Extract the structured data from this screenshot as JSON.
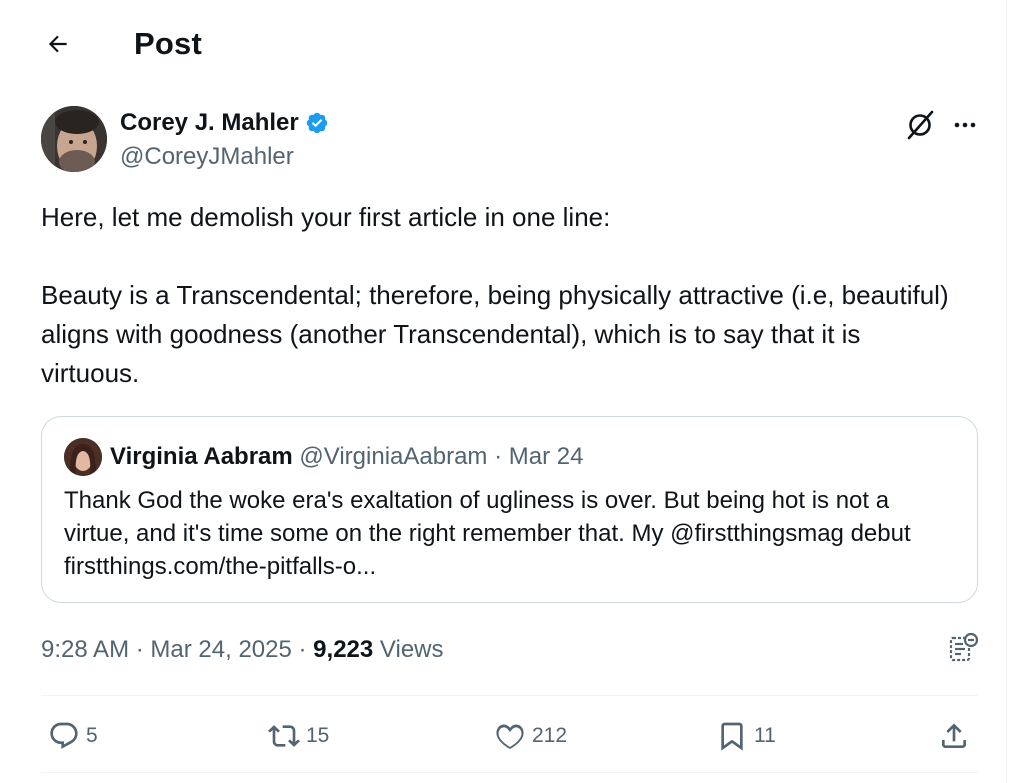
{
  "header": {
    "title": "Post"
  },
  "author": {
    "name": "Corey J. Mahler",
    "handle": "@CoreyJMahler",
    "verified": true
  },
  "post": {
    "text": "Here, let me demolish your first article in one line:\n\nBeauty is a Transcendental; therefore, being physically attractive (i.e, beautiful) aligns with goodness (another Transcendental), which is to say that it is virtuous."
  },
  "quote": {
    "name": "Virginia Aabram",
    "handle": "@VirginiaAabram",
    "separator": "·",
    "date": "Mar 24",
    "text": "Thank God the woke era's exaltation of ugliness is over. But being hot is not a virtue, and it's time some on the right remember that. My @firstthingsmag debut firstthings.com/the-pitfalls-o..."
  },
  "meta": {
    "time": "9:28 AM",
    "date": "Mar 24, 2025",
    "separator": "·",
    "views_count": "9,223",
    "views_label": "Views"
  },
  "actions": {
    "replies": "5",
    "reposts": "15",
    "likes": "212",
    "bookmarks": "11"
  },
  "colors": {
    "text": "#0f1419",
    "secondary": "#536471",
    "verified": "#1d9bf0",
    "border": "#cfd9de"
  },
  "icons": [
    "back-arrow-icon",
    "verified-badge-icon",
    "grok-icon",
    "more-icon",
    "analytics-icon",
    "reply-icon",
    "repost-icon",
    "like-icon",
    "bookmark-icon",
    "share-icon"
  ]
}
